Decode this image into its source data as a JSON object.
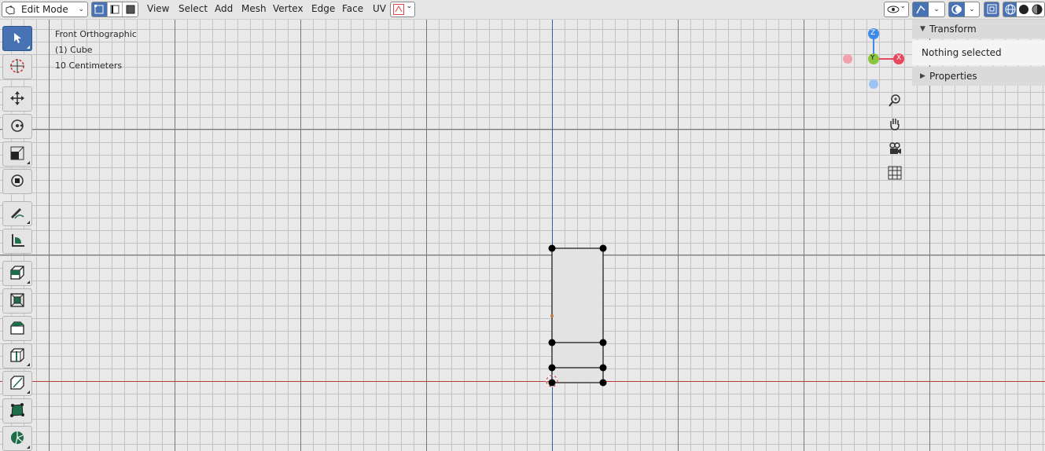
{
  "header": {
    "mode_select": {
      "value": "Edit Mode"
    },
    "menu": [
      "View",
      "Select",
      "Add",
      "Mesh",
      "Vertex",
      "Edge",
      "Face",
      "UV"
    ]
  },
  "viewport": {
    "view_name": "Front Orthographic",
    "object_name": "(1) Cube",
    "grid_scale": "10 Centimeters"
  },
  "gizmo": {
    "z_label": "Z",
    "y_label": "Y",
    "x_label": "X"
  },
  "sidebar": {
    "transform_title": "Transform",
    "transform_body": "Nothing selected",
    "properties_title": "Properties"
  },
  "colors": {
    "accent": "#4772b3",
    "axis_x": "#e8485e",
    "axis_y": "#8cc63f",
    "axis_z": "#3d8be8",
    "x_axis_line": "#b83c3c",
    "z_axis_line": "#3a5a9a",
    "tool_green": "#1e6e4a"
  },
  "tools": [
    "select-box-icon",
    "cursor-icon",
    "move-icon",
    "rotate-icon",
    "scale-icon",
    "transform-icon",
    "annotate-icon",
    "measure-icon",
    "extrude-region-icon",
    "inset-faces-icon",
    "bevel-icon",
    "loop-cut-icon",
    "knife-icon",
    "poly-build-icon",
    "spin-icon"
  ]
}
